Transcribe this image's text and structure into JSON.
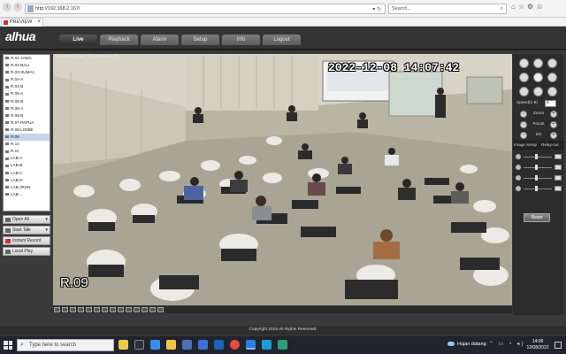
{
  "browser": {
    "address": "http://192.168.2.167/",
    "search_placeholder": "Search...",
    "tab_title": "PREVIEW"
  },
  "app": {
    "logo": "alhua",
    "nav": [
      "Live",
      "Playback",
      "Alarm",
      "Setup",
      "Info",
      "Logout"
    ],
    "active_nav": "Live",
    "channels": [
      "R.01-JAWA",
      "R.02-BALI",
      "R.03-SUMA1",
      "R.04-A",
      "R.04-B",
      "R.05-A",
      "R.05-B",
      "R.06-A",
      "R.06-B",
      "R.07-PAPUA",
      "R.08-LOMBI",
      "R.09",
      "R.10",
      "R.11",
      "LAB-A",
      "LAB-B",
      "LAB-C",
      "LAB-D",
      "LAB-JRSN",
      "LAB-..."
    ],
    "selected_channel": "R.09",
    "side_buttons": {
      "open_all": "Open All",
      "start_talk": "Start Talk",
      "instant_record": "Instant Record",
      "local_play": "Local Play"
    },
    "video": {
      "info": "192.168.2.167_12_9236bps_M",
      "timestamp": "2022-12-08 14:07:42",
      "camera_label": "R.09"
    },
    "ptz": {
      "speed_label": "Speed(1-8)",
      "speed_value": "5",
      "zoom": "Zoom",
      "focus": "Focus",
      "iris": "Iris"
    },
    "image_setup": {
      "title": "Image Setup",
      "relay": "Relay-out",
      "reset": "Reset"
    },
    "copyright": "Copyright 2015 All Rights Reserved."
  },
  "taskbar": {
    "search_placeholder": "Type here to search",
    "weather": "Hujan datang",
    "time": "14:08",
    "date": "12/08/2022"
  },
  "colors": {
    "app_bg": "#343434",
    "tab_active": "#2c2c2c",
    "timestamp": "#ffffff",
    "taskbar": "#20242d"
  }
}
